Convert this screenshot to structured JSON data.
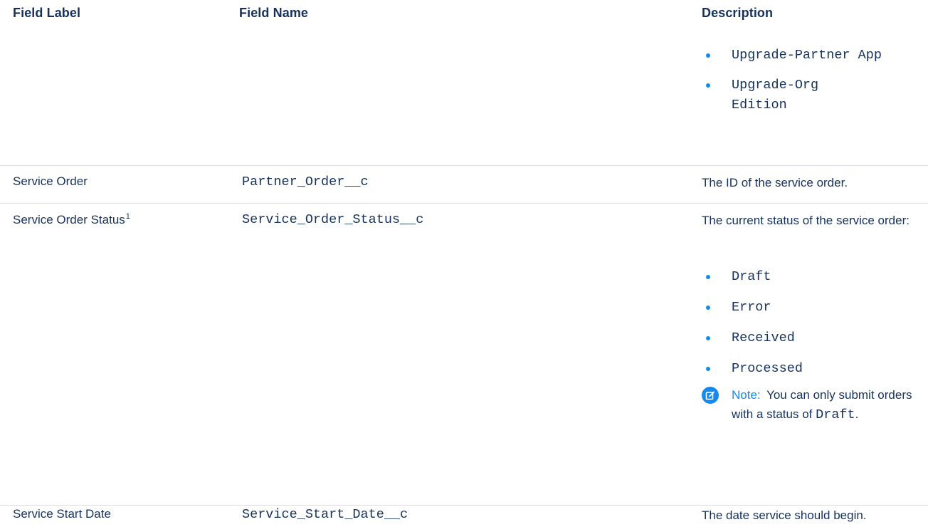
{
  "table": {
    "headers": {
      "field_label": "Field Label",
      "field_name": "Field Name",
      "description": "Description"
    },
    "continued_row": {
      "bullets": [
        "Upgrade-Partner App",
        "Upgrade-Org Edition"
      ]
    },
    "rows": [
      {
        "label": "Service Order",
        "name": "Partner_Order__c",
        "description": "The ID of the service order."
      },
      {
        "label": "Service Order Status",
        "label_footnote": "1",
        "name": "Service_Order_Status__c",
        "description": "The current status of the service order:",
        "bullets": [
          "Draft",
          "Error",
          "Received",
          "Processed"
        ],
        "note": {
          "label": "Note:",
          "text_before": "You can only submit orders with a status of",
          "code": "Draft",
          "text_after": ".",
          "icon": "edit-note-icon"
        }
      },
      {
        "label": "Service Start Date",
        "name": "Service_Start_Date__c",
        "description": "The date service should begin."
      }
    ]
  },
  "colors": {
    "text": "#16325c",
    "accent": "#1589ee",
    "divider": "#d8dde6"
  }
}
